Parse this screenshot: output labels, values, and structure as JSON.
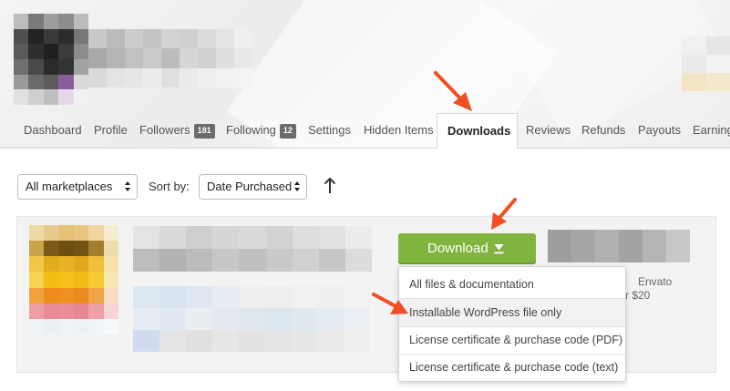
{
  "tabs": [
    {
      "label": "Dashboard"
    },
    {
      "label": "Profile"
    },
    {
      "label": "Followers",
      "badge": "181"
    },
    {
      "label": "Following",
      "badge": "12"
    },
    {
      "label": "Settings"
    },
    {
      "label": "Hidden Items"
    },
    {
      "label": "Downloads",
      "active": true
    },
    {
      "label": "Reviews"
    },
    {
      "label": "Refunds"
    },
    {
      "label": "Payouts"
    },
    {
      "label": "Earning"
    }
  ],
  "filters": {
    "marketplace": "All marketplaces",
    "sort_label": "Sort by:",
    "sort_value": "Date Purchased"
  },
  "item": {
    "download_label": "Download",
    "menu": [
      "All files & documentation",
      "Installable WordPress file only",
      "License certificate & purchase code (PDF)",
      "License certificate & purchase code (text)"
    ],
    "side_text_1": "Envato",
    "side_text_2": "r $20"
  },
  "colors": {
    "accent_green": "#82b440",
    "annotation_arrow": "#f04e23"
  }
}
